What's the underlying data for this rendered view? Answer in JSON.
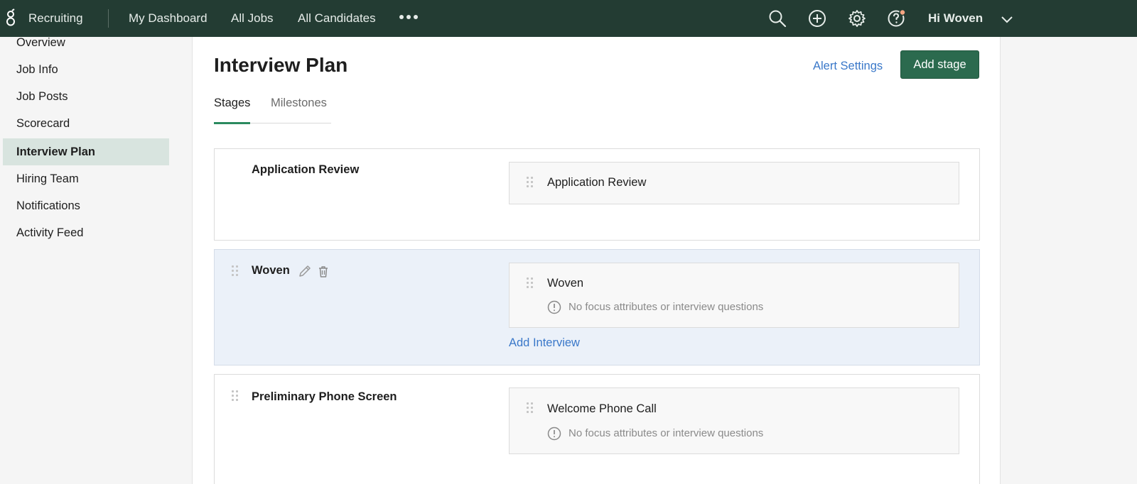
{
  "topnav": {
    "app_name": "Recruiting",
    "links": [
      "My Dashboard",
      "All Jobs",
      "All Candidates"
    ],
    "user_greeting": "Hi Woven",
    "notification_dot_color": "#f4a582"
  },
  "sidebar": {
    "items": [
      {
        "label": "Overview",
        "active": false
      },
      {
        "label": "Job Info",
        "active": false
      },
      {
        "label": "Job Posts",
        "active": false
      },
      {
        "label": "Scorecard",
        "active": false
      },
      {
        "label": "Interview Plan",
        "active": true
      },
      {
        "label": "Hiring Team",
        "active": false
      },
      {
        "label": "Notifications",
        "active": false
      },
      {
        "label": "Activity Feed",
        "active": false
      }
    ]
  },
  "main": {
    "title": "Interview Plan",
    "alert_settings_label": "Alert Settings",
    "add_stage_label": "Add stage",
    "tabs": [
      {
        "label": "Stages",
        "active": true
      },
      {
        "label": "Milestones",
        "active": false
      }
    ],
    "stages": [
      {
        "name": "Application Review",
        "interviews": [
          {
            "name": "Application Review"
          }
        ]
      },
      {
        "name": "Woven",
        "interviews": [
          {
            "name": "Woven",
            "note": "No focus attributes or interview questions"
          }
        ],
        "add_interview_label": "Add Interview"
      },
      {
        "name": "Preliminary Phone Screen",
        "interviews": [
          {
            "name": "Welcome Phone Call",
            "note": "No focus attributes or interview questions"
          }
        ]
      }
    ]
  },
  "colors": {
    "nav_bg": "#233c33",
    "accent_green": "#2b6a4e",
    "link_blue": "#3a78c9",
    "highlight_row": "#ebf1f9",
    "sidebar_active": "#d8e4df"
  }
}
